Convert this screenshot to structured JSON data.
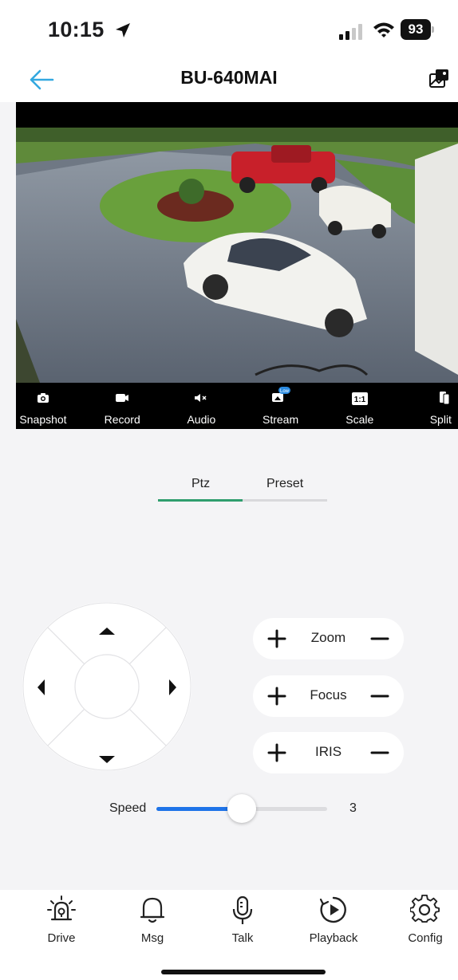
{
  "status_bar": {
    "time": "10:15",
    "battery": "93"
  },
  "header": {
    "title": "BU-640MAI"
  },
  "video_toolbar": {
    "items": [
      {
        "label": "Snapshot",
        "icon": "camera-icon"
      },
      {
        "label": "Record",
        "icon": "video-record-icon"
      },
      {
        "label": "Audio",
        "icon": "speaker-mute-icon"
      },
      {
        "label": "Stream",
        "icon": "stream-icon",
        "badge": "Low"
      },
      {
        "label": "Scale",
        "icon": "scale-icon",
        "badge": "1:1"
      },
      {
        "label": "Split",
        "icon": "split-icon"
      }
    ]
  },
  "ptz_tabs": {
    "tabs": [
      "Ptz",
      "Preset"
    ],
    "active": "Ptz"
  },
  "lens_controls": [
    {
      "label": "Zoom"
    },
    {
      "label": "Focus"
    },
    {
      "label": "IRIS"
    }
  ],
  "speed": {
    "label": "Speed",
    "value": "3",
    "fraction": 0.5
  },
  "bottom_nav": {
    "items": [
      {
        "label": "Drive",
        "icon": "siren-icon"
      },
      {
        "label": "Msg",
        "icon": "bell-icon"
      },
      {
        "label": "Talk",
        "icon": "microphone-icon"
      },
      {
        "label": "Playback",
        "icon": "playback-icon"
      },
      {
        "label": "Config",
        "icon": "gear-icon"
      }
    ]
  },
  "colors": {
    "accent_blue": "#1e73e8",
    "tab_green": "#2f9e6e",
    "back_arrow": "#33a8e0"
  }
}
